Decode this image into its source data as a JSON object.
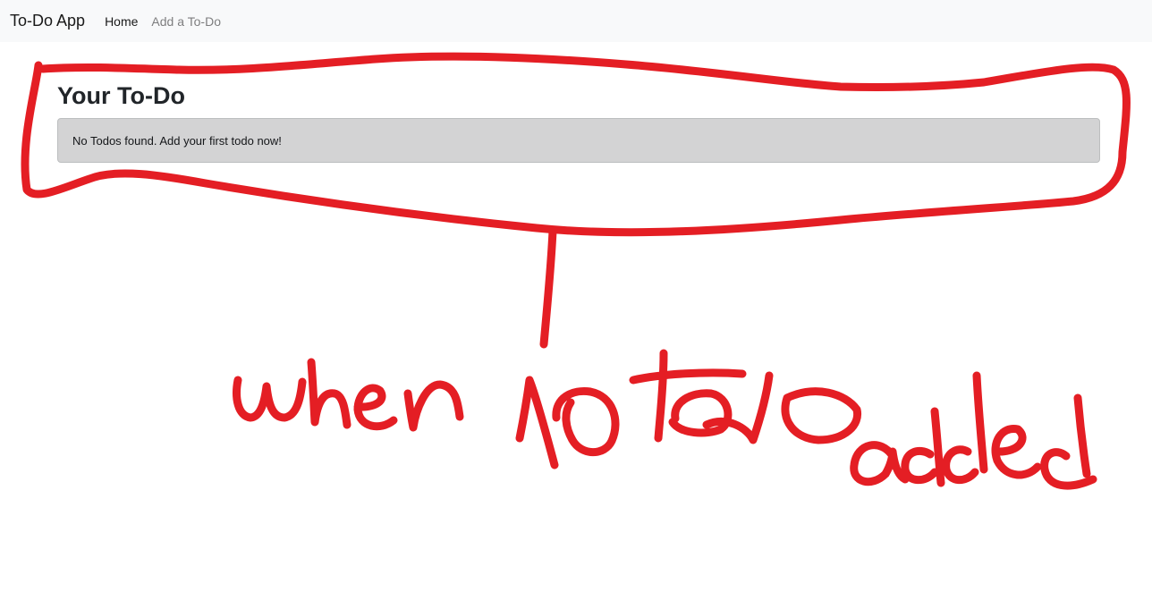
{
  "navbar": {
    "brand": "To-Do App",
    "links": [
      {
        "label": "Home",
        "active": true
      },
      {
        "label": "Add a To-Do",
        "active": false
      }
    ]
  },
  "main": {
    "title": "Your To-Do",
    "empty_message": "No Todos found. Add your first todo now!"
  },
  "annotation": {
    "text": "when no todo added",
    "color": "#e41e24"
  }
}
